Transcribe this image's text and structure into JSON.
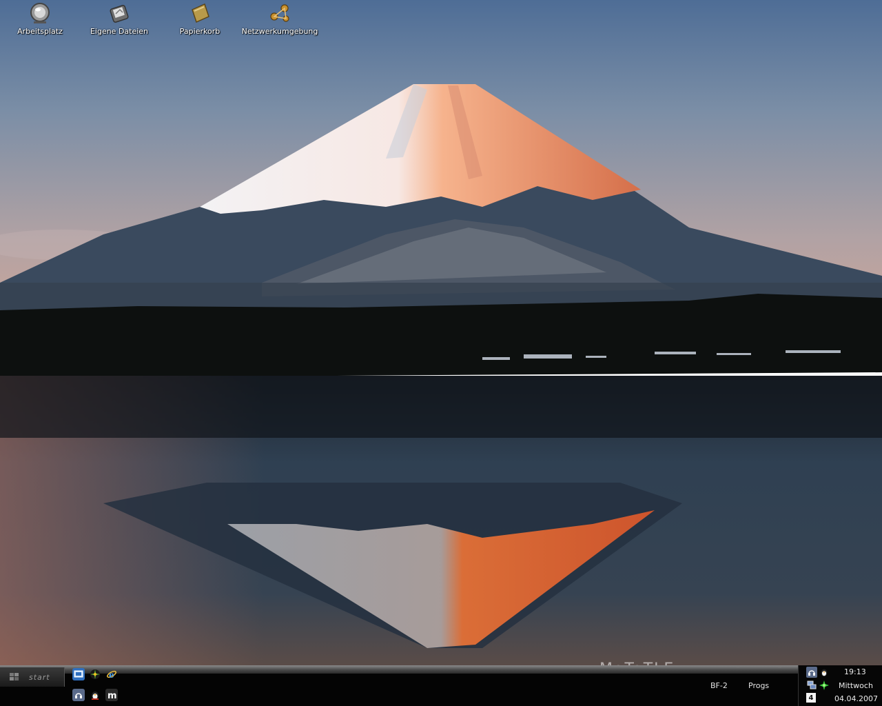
{
  "desktop": {
    "icons": [
      {
        "label": "Arbeitsplatz",
        "icon": "my-computer-icon"
      },
      {
        "label": "Eigene Dateien",
        "icon": "my-documents-icon"
      },
      {
        "label": "Papierkorb",
        "icon": "recycle-bin-icon"
      },
      {
        "label": "Netzwerkumgebung",
        "icon": "network-places-icon"
      }
    ],
    "watermark": "MaTaTLE"
  },
  "taskbar": {
    "start_label": "start",
    "quick_launch": [
      {
        "icon": "show-desktop-icon"
      },
      {
        "icon": "colorful-app-icon"
      },
      {
        "icon": "internet-explorer-icon"
      },
      {
        "icon": "headphones-app-icon"
      },
      {
        "icon": "messenger-icon"
      },
      {
        "icon": "m-app-icon"
      }
    ],
    "toolbars": {
      "bf2_label": "BF-2",
      "progs_label": "Progs"
    }
  },
  "tray": {
    "time": "19:13",
    "weekday": "Mittwoch",
    "date": "04.04.2007",
    "calendar_day": "4",
    "icons": [
      "headphones-tray-icon",
      "messenger-tray-icon",
      "network-tray-icon",
      "green-star-tray-icon",
      "calendar-tray-icon"
    ]
  },
  "colors": {
    "taskbar_bg": "#040404",
    "sky_top": "#4e6d96",
    "lake": "#2a3a4e",
    "sunset_orange": "#f0783c"
  }
}
